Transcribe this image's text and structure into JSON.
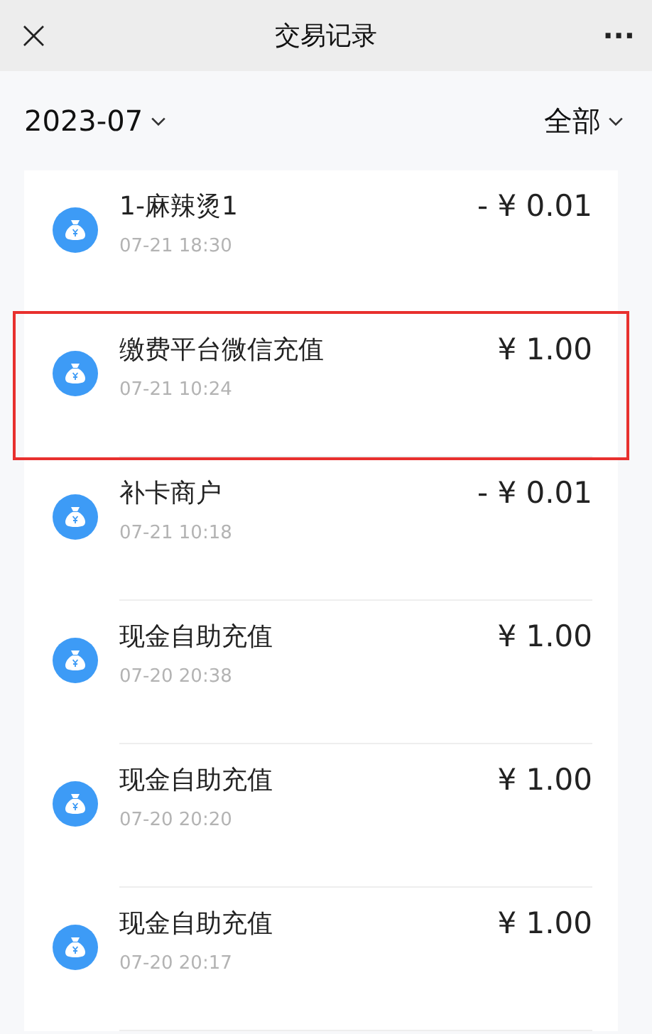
{
  "header": {
    "close": "×",
    "title": "交易记录",
    "more": "···"
  },
  "filters": {
    "month": "2023-07",
    "category": "全部"
  },
  "transactions": [
    {
      "name": "1-麻辣烫1",
      "time": "07-21 18:30",
      "amount": "- ¥ 0.01",
      "highlighted": false
    },
    {
      "name": "缴费平台微信充值",
      "time": "07-21 10:24",
      "amount": "¥ 1.00",
      "highlighted": true
    },
    {
      "name": "补卡商户",
      "time": "07-21 10:18",
      "amount": "- ¥ 0.01",
      "highlighted": false
    },
    {
      "name": "现金自助充值",
      "time": "07-20 20:38",
      "amount": "¥ 1.00",
      "highlighted": false
    },
    {
      "name": "现金自助充值",
      "time": "07-20 20:20",
      "amount": "¥ 1.00",
      "highlighted": false
    },
    {
      "name": "现金自助充值",
      "time": "07-20 20:17",
      "amount": "¥ 1.00",
      "highlighted": false
    }
  ]
}
